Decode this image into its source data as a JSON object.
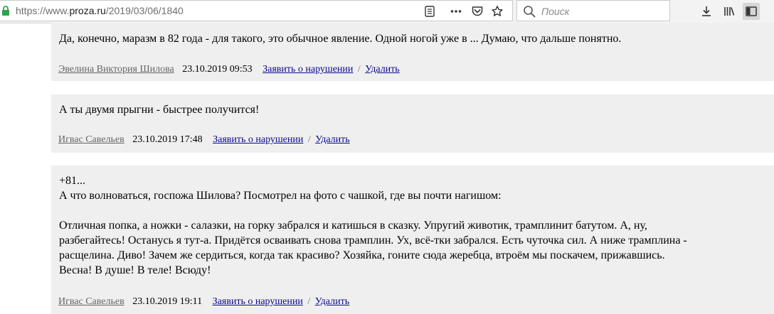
{
  "browser": {
    "url_prefix": "https://www.",
    "url_host": "proza.ru",
    "url_path": "/2019/03/06/1840",
    "search_placeholder": "Поиск"
  },
  "colors": {
    "comment_bg": "#efefef",
    "link": "#0a0a8e",
    "author": "#666666",
    "lock": "#2ea44f"
  },
  "comments": [
    {
      "lines": [
        "Да, конечно, маразм в 82 года - для такого, это обычное явление. Одной ногой уже в ... Думаю, что дальше понятно."
      ],
      "author": "Эвелина Виктория Шилова",
      "date": "23.10.2019 09:53",
      "report": "Заявить о нарушении",
      "sep": "/",
      "delete": "Удалить"
    },
    {
      "lines": [
        "А ты двумя прыгни - быстрее получится!"
      ],
      "author": "Игвас Савельев",
      "date": "23.10.2019 17:48",
      "report": "Заявить о нарушении",
      "sep": "/",
      "delete": "Удалить"
    },
    {
      "lines": [
        "+81...",
        "А что волноваться, госпожа Шилова? Посмотрел на фото с чашкой, где вы почти нагишом:",
        "",
        "Отличная попка, а ножки - салазки, на горку забрался и катишься в сказку. Упругий животик, трамплинит батутом. А, ну,",
        "разбегайтесь! Останусь я тут-а. Придётся осваивать снова трамплин. Ух, всё-тки забрался. Есть чуточка сил. А ниже трамплина -",
        "расщелина. Диво! Зачем же сердиться, когда так красиво? Хозяйка, гоните сюда жеребца, втроём мы поскачем, прижавшись.",
        "Весна! В душе! В теле! Всюду!"
      ],
      "author": "Игвас Савельев",
      "date": "23.10.2019 19:11",
      "report": "Заявить о нарушении",
      "sep": "/",
      "delete": "Удалить"
    }
  ]
}
